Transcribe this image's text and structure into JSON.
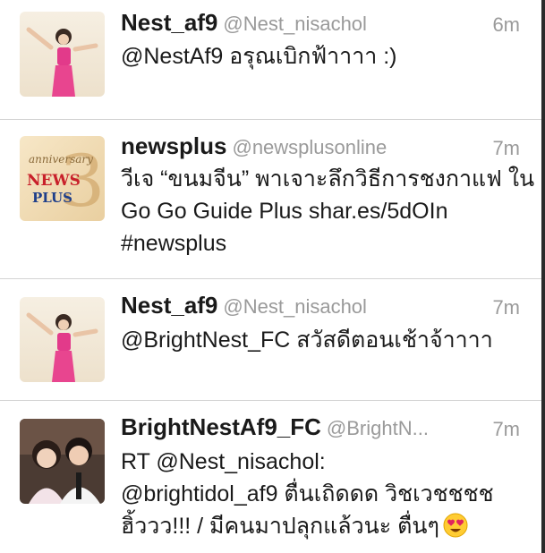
{
  "tweets": [
    {
      "name": "Nest_af9",
      "handle": "@Nest_nisachol",
      "time": "6m",
      "lines": [
        "@NestAf9 อรุณเบิกฟ้าาาา :)"
      ],
      "avatar_icon": "woman-in-pink-dress-avatar"
    },
    {
      "name": "newsplus",
      "handle": "@newsplusonline",
      "time": "7m",
      "lines": [
        "วีเจ “ขนมจีน” พาเจาะลึกวิธีการชงกาแฟ ใน",
        "Go Go Guide Plus shar.es/5dOIn",
        "#newsplus"
      ],
      "avatar_icon": "news-plus-logo-avatar",
      "avatar_text": {
        "top": "anniversary",
        "mid": "NEWS",
        "bottom": "PLUS",
        "num": "3"
      }
    },
    {
      "name": "Nest_af9",
      "handle": "@Nest_nisachol",
      "time": "7m",
      "lines": [
        "@BrightNest_FC สวัสดีตอนเช้าจ้าาาา"
      ],
      "avatar_icon": "woman-in-pink-dress-avatar"
    },
    {
      "name": "BrightNestAf9_FC",
      "handle": "@BrightN...",
      "time": "7m",
      "lines": [
        "RT @Nest_nisachol:",
        "@brightidol_af9 ตื่นเถิดดด วิชเวชชชช",
        "ฮิ้ววว!!! / มีคนมาปลุกแล้วนะ ตื่นๆ"
      ],
      "avatar_icon": "couple-photo-avatar"
    }
  ],
  "colors": {
    "name": "#1a1a1a",
    "meta": "#9a9a9a",
    "divider": "#d3d3d3",
    "pink": "#e23a8a"
  },
  "icons": {
    "heart_eyes": "heart-eyes-emoji-icon"
  }
}
